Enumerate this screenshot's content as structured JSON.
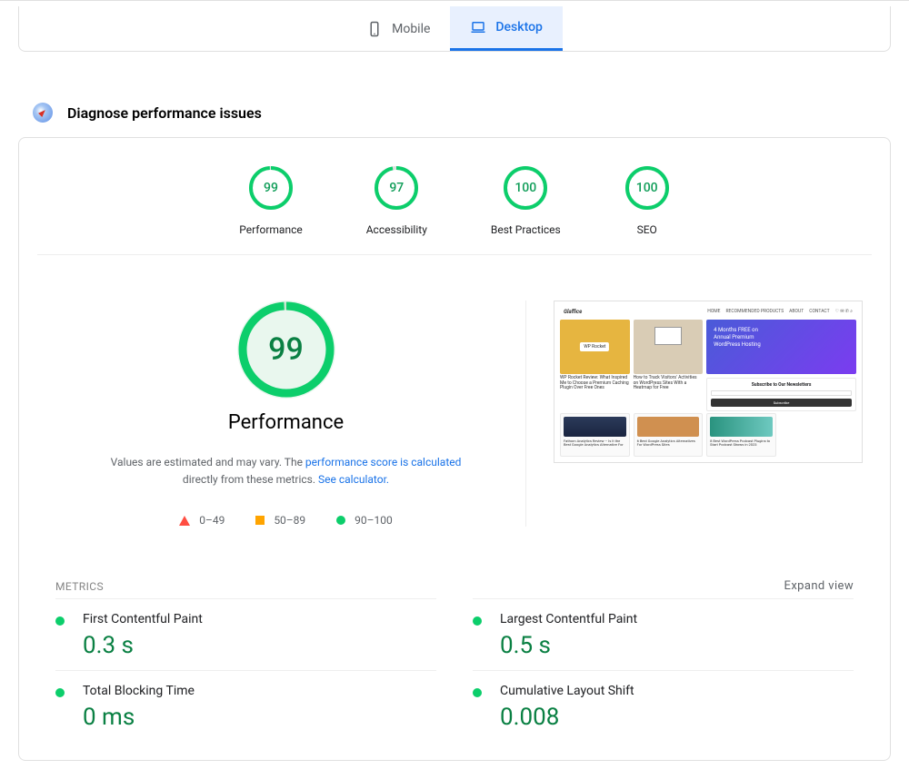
{
  "tabs": {
    "mobile": "Mobile",
    "desktop": "Desktop"
  },
  "section": {
    "title": "Diagnose performance issues"
  },
  "gauges": [
    {
      "value": "99",
      "pct": 99,
      "label": "Performance"
    },
    {
      "value": "97",
      "pct": 97,
      "label": "Accessibility"
    },
    {
      "value": "100",
      "pct": 100,
      "label": "Best Practices"
    },
    {
      "value": "100",
      "pct": 100,
      "label": "SEO"
    }
  ],
  "big_score": {
    "value": "99",
    "pct": 99,
    "title": "Performance"
  },
  "desc": {
    "prefix": "Values are estimated and may vary. The ",
    "link1": "performance score is calculated",
    "mid": " directly from these metrics. ",
    "link2": "See calculator."
  },
  "legend": {
    "low": "0–49",
    "mid": "50–89",
    "high": "90–100"
  },
  "metrics_header": {
    "label": "METRICS",
    "expand": "Expand view"
  },
  "metrics": [
    {
      "name": "First Contentful Paint",
      "value": "0.3 s"
    },
    {
      "name": "Largest Contentful Paint",
      "value": "0.5 s"
    },
    {
      "name": "Total Blocking Time",
      "value": "0 ms"
    },
    {
      "name": "Cumulative Layout Shift",
      "value": "0.008"
    }
  ],
  "thumb": {
    "logo": "Glaffice",
    "nav": [
      "HOME",
      "RECOMMENDED PRODUCTS",
      "ABOUT",
      "CONTACT"
    ],
    "card1_title": "WP Rocket",
    "card1_cap": "WP Rocket Review: What Inspired Me to Choose a Premium Caching Plugin Over Free Ones",
    "card2_cap": "How to Track Visitors' Activities on WordPress Sites With a Heatmap for Free",
    "card3a": "4 Months FREE on",
    "card3b": "Annual Premium",
    "card3c": "WordPress Hosting",
    "sub_title": "Subscribe to Our Newsletters",
    "sub_btn": "Subscribe",
    "r2a": "Fathom Analytics Review – Is It the Best Google Analytics Alternative For",
    "r2b": "6 Best Google Analytics Alternatives For WordPress Sites",
    "r2c": "8 Best WordPress Podcast Plugins to Start Podcast Shows in 2023"
  }
}
